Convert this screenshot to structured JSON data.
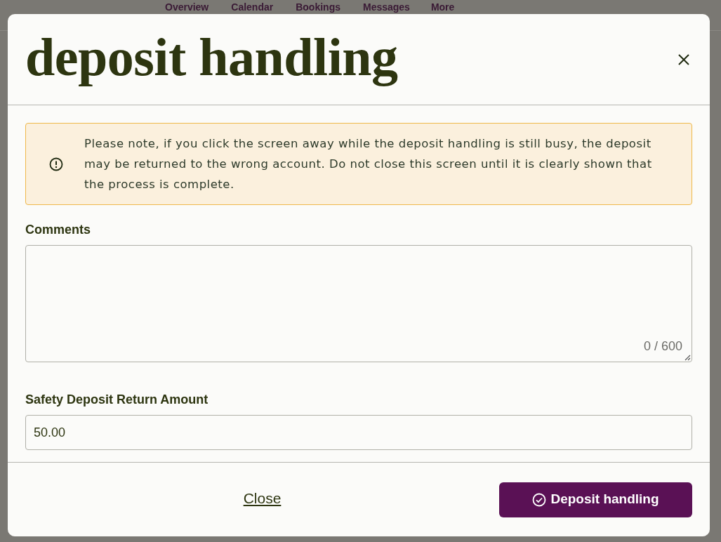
{
  "nav": [
    "Overview",
    "Calendar",
    "Bookings",
    "Messages",
    "More"
  ],
  "dialog": {
    "title": "deposit handling",
    "alert": "Please note, if you click the screen away while the deposit handling is still busy, the deposit may be returned to the wrong account. Do not close this screen until it is clearly shown that the process is complete.",
    "comments": {
      "label": "Comments",
      "counter": "0 / 600"
    },
    "amount": {
      "label": "Safety Deposit Return Amount",
      "value": "50.00"
    },
    "close_link": "Close",
    "submit_button": "Deposit handling"
  }
}
